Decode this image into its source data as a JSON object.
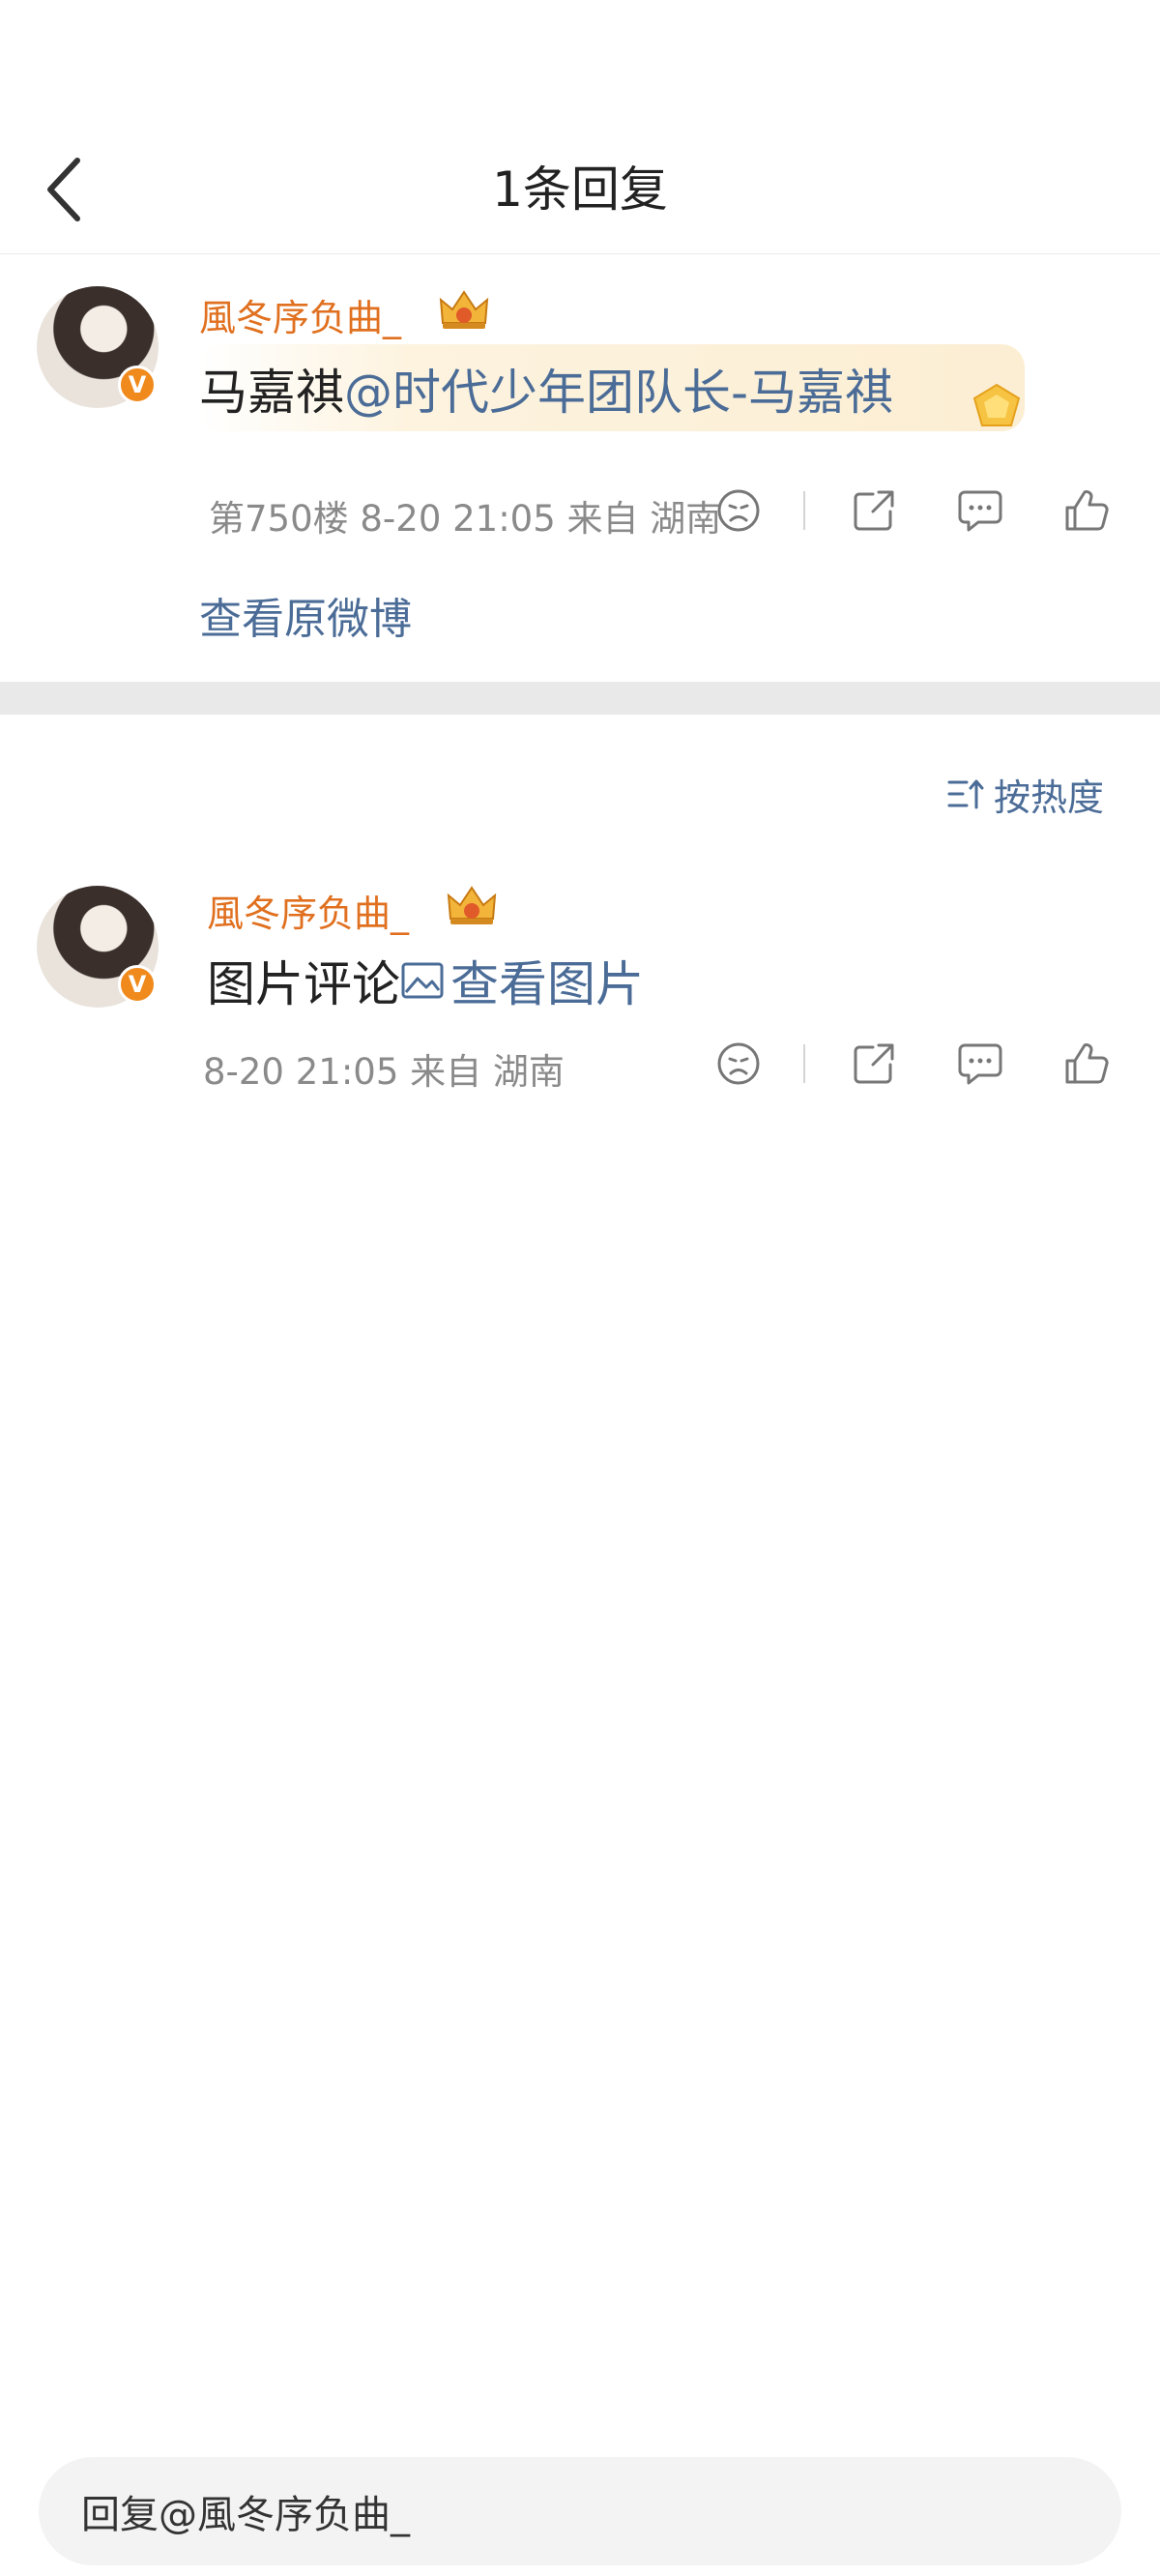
{
  "header": {
    "title": "1条回复"
  },
  "original_comment": {
    "username": "風冬序负曲_",
    "text_plain": "马嘉祺",
    "mention": "@时代少年团队长-马嘉祺",
    "meta": "第750楼 8-20 21:05 来自 湖南",
    "view_original_label": "查看原微博"
  },
  "sort": {
    "label": "按热度"
  },
  "reply": {
    "username": "風冬序负曲_",
    "text_plain": "图片评论 ",
    "view_image_label": "查看图片",
    "meta": "8-20 21:05 来自 湖南"
  },
  "reply_input": {
    "placeholder": "回复@風冬序负曲_"
  },
  "colors": {
    "accent_orange": "#e0701f",
    "link_blue": "#4b6c97",
    "badge_orange": "#f08a1c"
  },
  "icons": [
    "back-arrow-icon",
    "crown-badge-icon",
    "verified-v-icon",
    "dislike-face-icon",
    "share-icon",
    "comment-icon",
    "like-icon",
    "sort-icon",
    "image-icon"
  ]
}
